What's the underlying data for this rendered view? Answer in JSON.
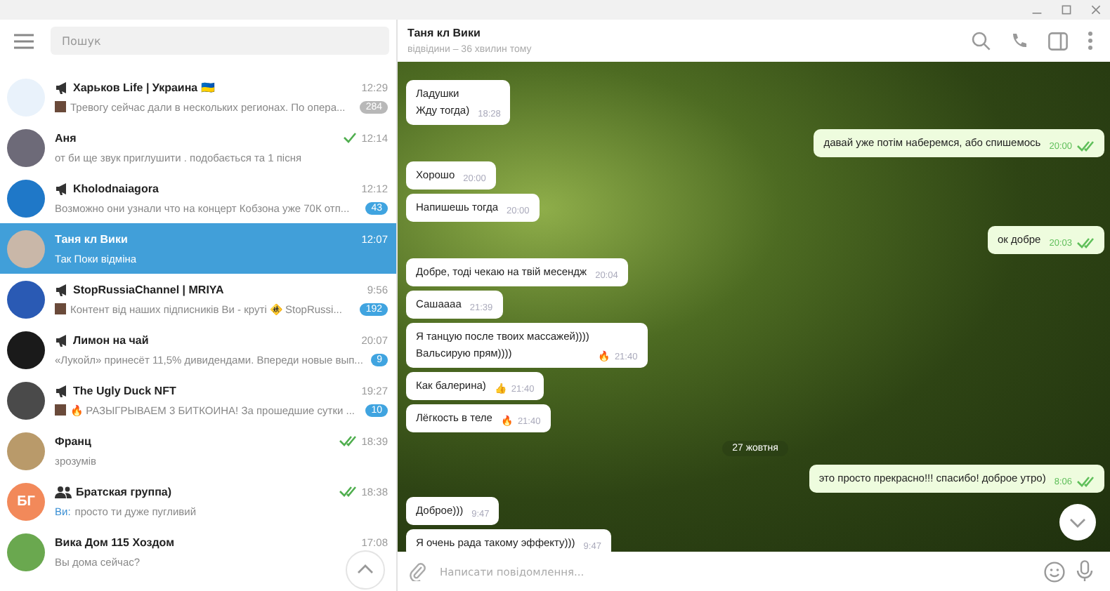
{
  "search": {
    "placeholder": "Пошук"
  },
  "chats": [
    {
      "name": "Харьков Life | Украина 🇺🇦",
      "kind": "channel",
      "color": "#e9f2fb",
      "time": "12:29",
      "thumb": true,
      "preview": "Тревогу сейчас дали в нескольких регионах. По опера...",
      "badge": "284",
      "muted": true,
      "selected": false
    },
    {
      "name": "Аня",
      "kind": "chat",
      "color": "#6d6a78",
      "time": "12:14",
      "read": false,
      "preview": "от би ще звук приглушити . подобається та 1 пісня",
      "selected": false
    },
    {
      "name": "Kholodnaiagora",
      "kind": "channel",
      "color": "#1f78c8",
      "time": "12:12",
      "preview": "Возможно они узнали что на концерт Кобзона уже 70К отп...",
      "badge": "43",
      "muted": false,
      "selected": false
    },
    {
      "name": "Таня кл Вики",
      "kind": "chat",
      "color": "#c9b7a8",
      "time": "12:07",
      "preview": "Так Поки відміна",
      "selected": true
    },
    {
      "name": "StopRussiaChannel | MRIYA",
      "kind": "channel",
      "color": "#2a5ab4",
      "time": "9:56",
      "thumb": true,
      "preview": "Контент від наших підписників Ви - круті 🚸 StopRussi...",
      "badge": "192",
      "muted": false,
      "selected": false
    },
    {
      "name": "Лимон на чай",
      "kind": "channel",
      "color": "#1a1a1a",
      "time": "20:07",
      "preview": "«Лукойл» принесёт 11,5% дивидендами. Впереди новые вып...",
      "badge": "9",
      "muted": false,
      "selected": false
    },
    {
      "name": "The Ugly Duck NFT",
      "kind": "channel",
      "color": "#4a4a4a",
      "time": "19:27",
      "thumb": true,
      "preview": "🔥 РАЗЫГРЫВАЕМ 3 БИТКОИНА! За прошедшие сутки ...",
      "badge": "10",
      "muted": false,
      "selected": false
    },
    {
      "name": "Франц",
      "kind": "chat",
      "color": "#b99a6a",
      "time": "18:39",
      "read": true,
      "preview": "зрозумів",
      "selected": false
    },
    {
      "name": "Братская группа)",
      "kind": "group",
      "color": "#f2895a",
      "initials": "БГ",
      "time": "18:38",
      "read": true,
      "sender": "Ви:",
      "preview": "просто ти дуже пугливий",
      "selected": false
    },
    {
      "name": "Вика Дом 115 Хоздом",
      "kind": "chat",
      "color": "#6aa84f",
      "time": "17:08",
      "preview": "Вы дома сейчас?",
      "selected": false
    }
  ],
  "chat": {
    "title": "Таня кл Вики",
    "status": "відвідини – 36 хвилин тому"
  },
  "messages": [
    {
      "kind": "in",
      "text": "Ладушки\nЖду тогда)",
      "time": "18:28"
    },
    {
      "kind": "out",
      "text": "давай уже потім наберемся, або спишемось",
      "time": "20:00",
      "read": true
    },
    {
      "kind": "in",
      "text": "Хорошо",
      "time": "20:00"
    },
    {
      "kind": "in",
      "text": "Напишешь тогда",
      "time": "20:00"
    },
    {
      "kind": "out",
      "text": "ок добре",
      "time": "20:03",
      "read": true
    },
    {
      "kind": "in",
      "text": "Добре, тоді чекаю на твій месендж",
      "time": "20:04"
    },
    {
      "kind": "in",
      "text": "Сашаааа",
      "time": "21:39"
    },
    {
      "kind": "in",
      "text": "Я танцую после твоих массажей))))\nВальсирую прям))))",
      "time": "21:40",
      "reaction": "🔥"
    },
    {
      "kind": "in",
      "text": "Как балерина)",
      "time": "21:40",
      "reaction": "👍"
    },
    {
      "kind": "in",
      "text": "Лёгкость в теле",
      "time": "21:40",
      "reaction": "🔥"
    },
    {
      "kind": "date",
      "text": "27 жовтня"
    },
    {
      "kind": "out",
      "text": "это просто прекрасно!!! спасибо! доброе утро)",
      "time": "8:06",
      "read": true
    },
    {
      "kind": "in",
      "text": "Доброе)))",
      "time": "9:47"
    },
    {
      "kind": "in",
      "text": "Я очень рада такому эффекту)))",
      "time": "9:47"
    }
  ],
  "composer": {
    "placeholder": "Написати повідомлення..."
  }
}
